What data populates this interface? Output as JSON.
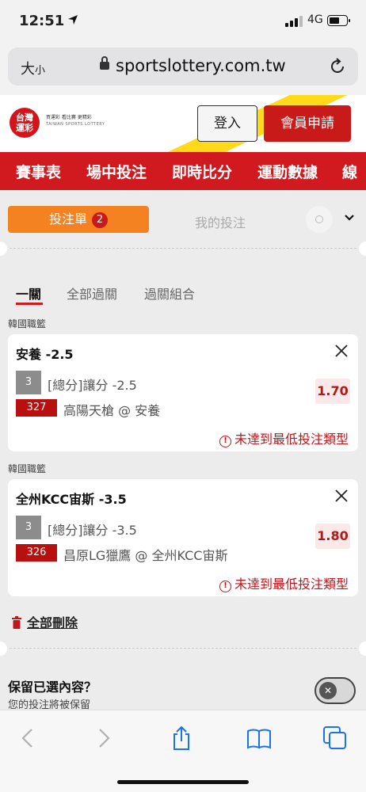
{
  "status_bar": {
    "time": "12:51",
    "network": "4G"
  },
  "browser": {
    "text_size": "大",
    "text_size_small": "小",
    "url": "sportslottery.com.tw"
  },
  "site": {
    "logo_line1": "台灣",
    "logo_line2": "運彩",
    "logo_sub1": "買運彩 看比賽 更精彩",
    "logo_sub2": "TAIWAN SPORTS LOTTERY",
    "login_label": "登入",
    "register_label": "會員申請"
  },
  "nav": {
    "items": [
      "賽事表",
      "場中投注",
      "即時比分",
      "運動數據",
      "線"
    ]
  },
  "betslip": {
    "tab_label": "投注單",
    "tab_count": "2",
    "my_bets_label": "我的投注",
    "subtabs": [
      "一關",
      "全部過關",
      "過關組合"
    ],
    "bets": [
      {
        "league": "韓國職籃",
        "title": "安養 -2.5",
        "market_code": "3",
        "market": "[總分]讓分 -2.5",
        "match_code": "327",
        "match": "高陽天槍 @ 安養",
        "odds": "1.70",
        "warning": "未達到最低投注類型"
      },
      {
        "league": "韓國職籃",
        "title": "全州KCC宙斯 -3.5",
        "market_code": "3",
        "market": "[總分]讓分 -3.5",
        "match_code": "326",
        "match": "昌原LG獵鷹 @ 全州KCC宙斯",
        "odds": "1.80",
        "warning": "未達到最低投注類型"
      }
    ],
    "delete_all": "全部刪除",
    "retain_title": "保留已選內容？",
    "retain_sub": "您的投注將被保留",
    "retain_toggle": "off"
  },
  "icons": {
    "back": "chevron-left-icon",
    "forward": "chevron-right-icon",
    "share": "share-icon",
    "bookmarks": "book-icon",
    "tabs": "tabs-icon"
  },
  "colors": {
    "brand_red": "#d11a1f",
    "accent_orange": "#f58220",
    "odds_red": "#b01a1a"
  }
}
